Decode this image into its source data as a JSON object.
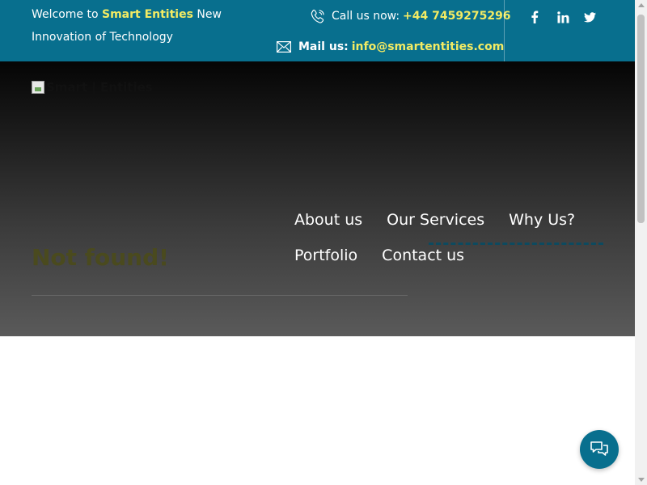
{
  "topbar": {
    "welcome_prefix": "Welcome to",
    "brand": "Smart Entities",
    "welcome_suffix": "New Innovation of Technology",
    "call_label": "Call us now:",
    "phone": "+44 7459275296",
    "mail_label": "Mail us:",
    "email": "info@smartentities.com",
    "social": [
      "facebook-icon",
      "linkedin-icon",
      "twitter-icon"
    ],
    "bg_color": "#086f8e",
    "highlight_color": "#f3eb63"
  },
  "logo": {
    "alt": "Smart | Entities"
  },
  "nav": {
    "items": [
      "About us",
      "Our Services",
      "Why Us?",
      "Portfolio",
      "Contact us"
    ]
  },
  "hero": {
    "title": "Not found!"
  },
  "chat": {
    "icon": "chat-icon"
  }
}
